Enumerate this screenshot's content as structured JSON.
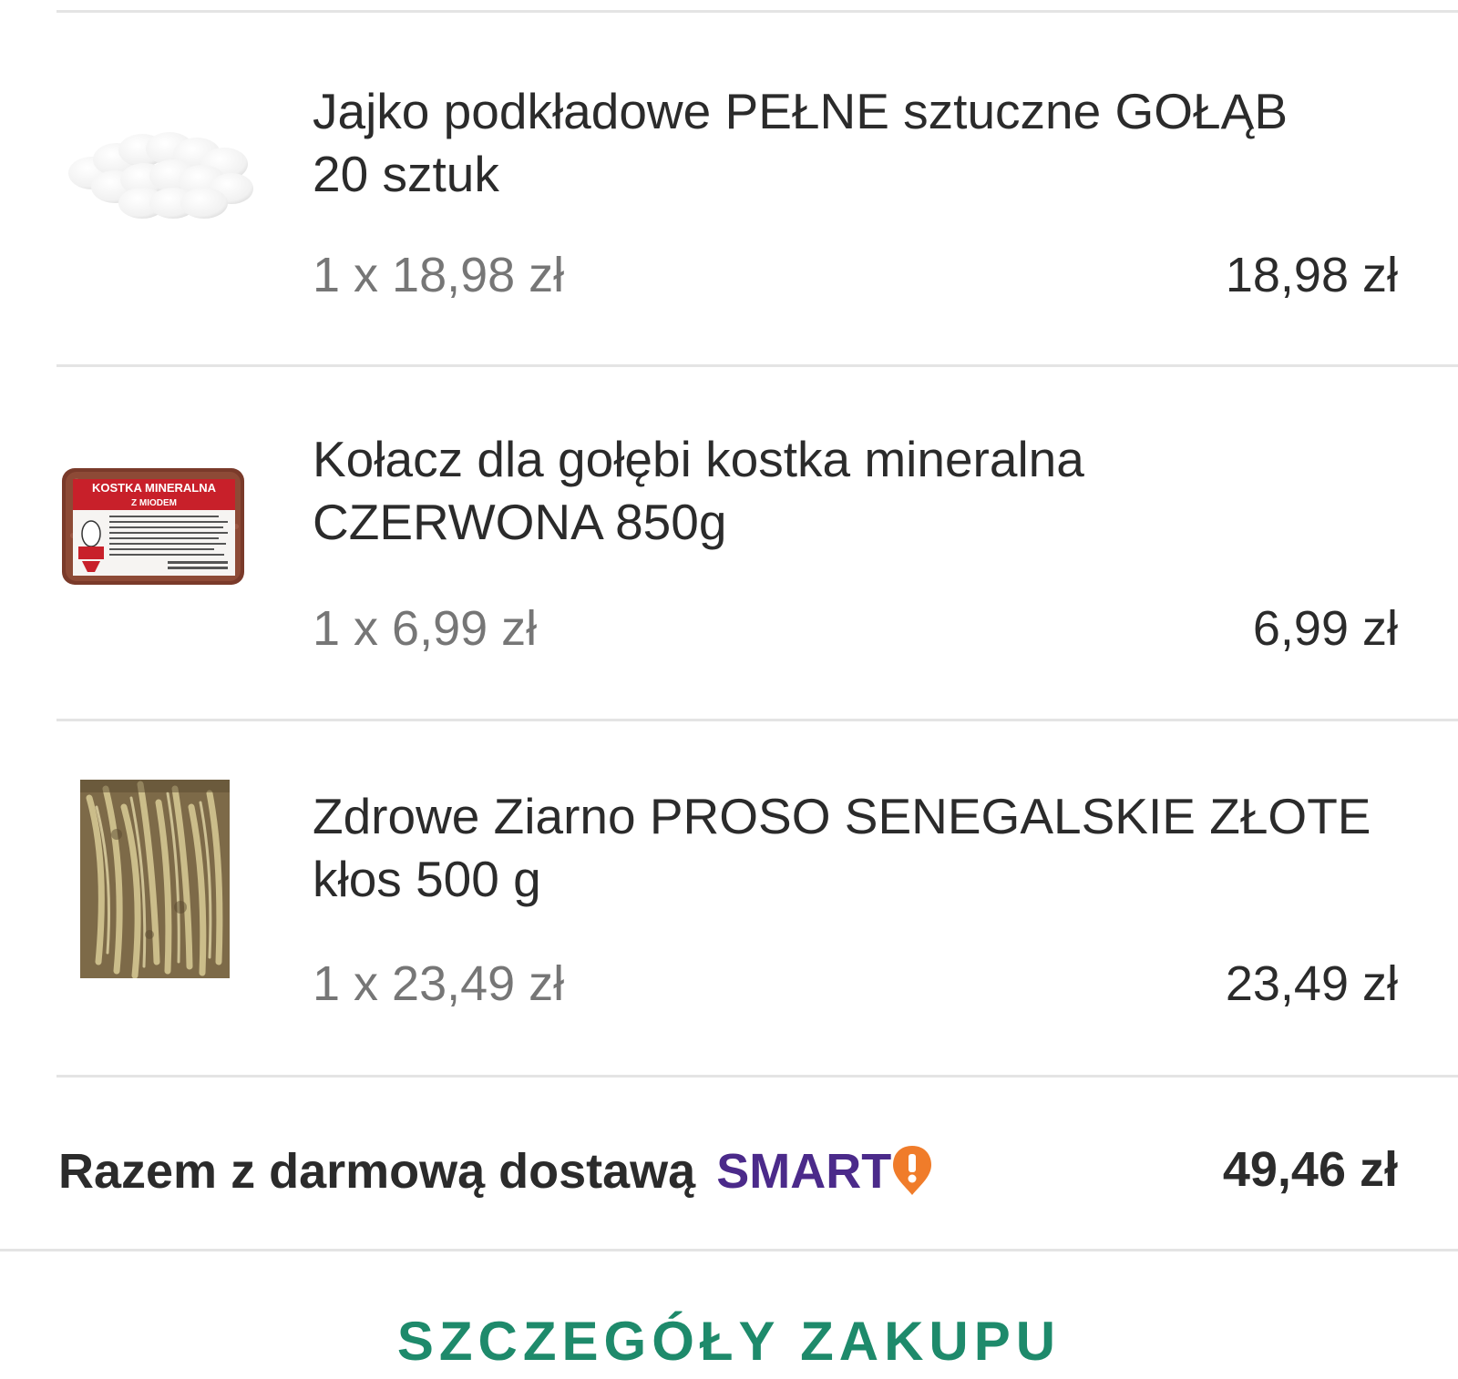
{
  "items": [
    {
      "title_line1": "Jajko podkładowe PEŁNE sztuczne GOŁĄB",
      "title_line2": "20 sztuk",
      "unit_price": "1 x 18,98 zł",
      "total": "18,98 zł",
      "image_icon": "white-eggs-thumbnail"
    },
    {
      "title_line1": "Kołacz dla gołębi kostka mineralna",
      "title_line2": "CZERWONA 850g",
      "unit_price": "1 x 6,99 zł",
      "total": "6,99 zł",
      "image_icon": "mineral-block-thumbnail",
      "image_label_line1": "KOSTKA MINERALNA",
      "image_label_line2": "Z MIODEM"
    },
    {
      "title_line1": "Zdrowe Ziarno PROSO SENEGALSKIE ZŁOTE",
      "title_line2": "kłos 500 g",
      "unit_price": "1 x 23,49 zł",
      "total": "23,49 zł",
      "image_icon": "millet-spray-thumbnail"
    }
  ],
  "summary": {
    "label": "Razem z darmową dostawą",
    "brand": "SMART",
    "brand_color": "#4b2a8a",
    "brand_icon_color": "#f07c2a",
    "value": "49,46 zł"
  },
  "details_button": "SZCZEGÓŁY ZAKUPU",
  "accent_color": "#1e8a6b"
}
